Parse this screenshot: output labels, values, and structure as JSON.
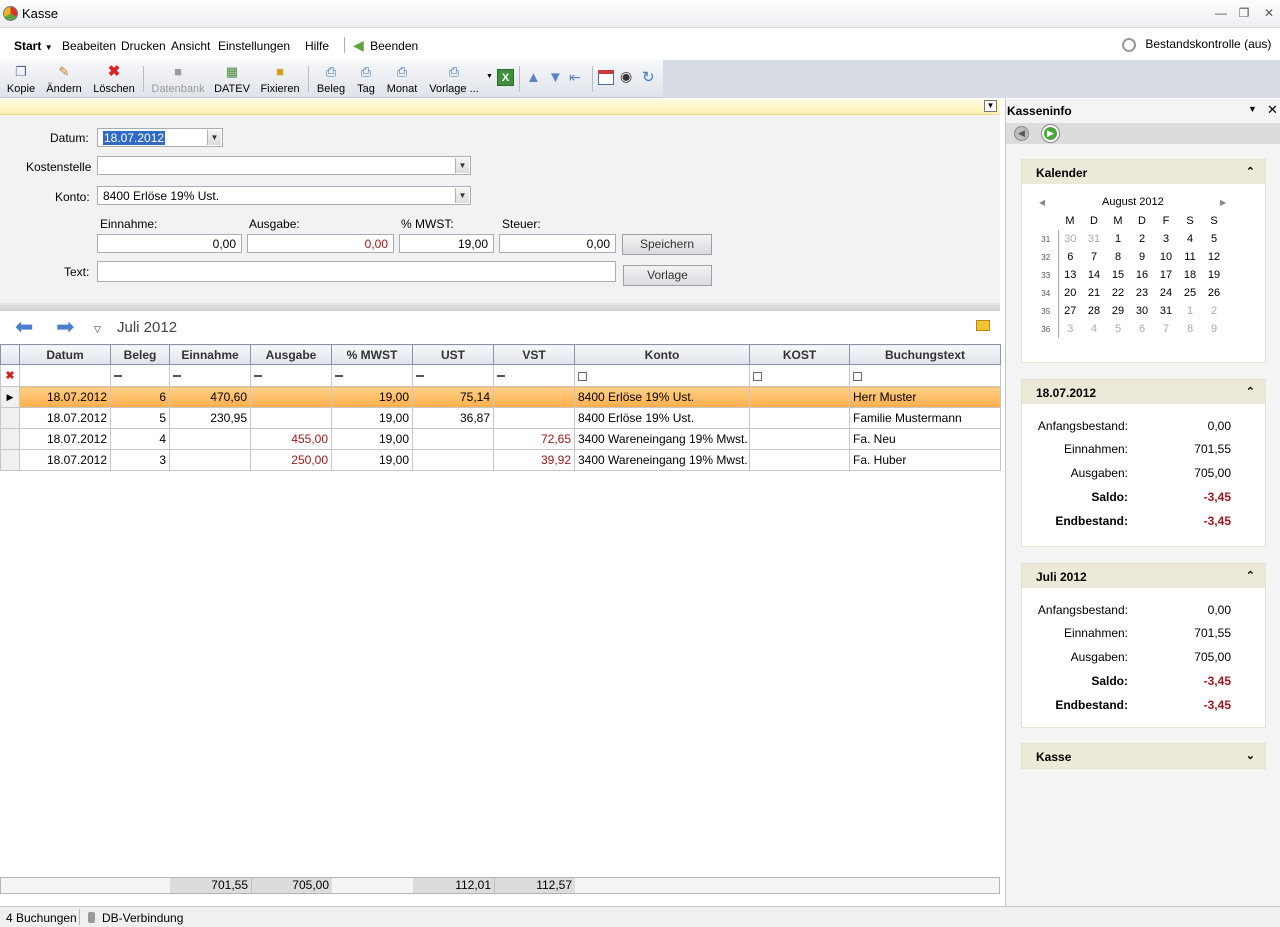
{
  "app": {
    "title": "Kasse"
  },
  "menu": {
    "start": "Start",
    "items": [
      "Beabeiten",
      "Drucken",
      "Ansicht",
      "Einstellungen",
      "Hilfe"
    ],
    "beenden": "Beenden",
    "bestandskontrolle": "Bestandskontrolle (aus)"
  },
  "toolbar": {
    "kopie": "Kopie",
    "aendern": "Ändern",
    "loeschen": "Löschen",
    "datenbank": "Datenbank",
    "datev": "DATEV",
    "fixieren": "Fixieren",
    "beleg": "Beleg",
    "tag": "Tag",
    "monat": "Monat",
    "vorlage": "Vorlage ..."
  },
  "form": {
    "datum_label": "Datum:",
    "datum_value": "18.07.2012",
    "kostenstelle_label": "Kostenstelle",
    "kostenstelle_value": "",
    "konto_label": "Konto:",
    "konto_value": "8400 Erlöse 19% Ust.",
    "einnahme_label": "Einnahme:",
    "ausgabe_label": "Ausgabe:",
    "mwst_label": "% MWST:",
    "steuer_label": "Steuer:",
    "einnahme_value": "0,00",
    "ausgabe_value": "0,00",
    "mwst_value": "19,00",
    "steuer_value": "0,00",
    "text_label": "Text:",
    "text_value": "",
    "speichern": "Speichern",
    "vorlage": "Vorlage"
  },
  "nav": {
    "month": "Juli 2012"
  },
  "grid": {
    "columns": [
      "Datum",
      "Beleg",
      "Einnahme",
      "Ausgabe",
      "% MWST",
      "UST",
      "VST",
      "Konto",
      "KOST",
      "Buchungstext"
    ],
    "rows": [
      {
        "datum": "18.07.2012",
        "beleg": "6",
        "einnahme": "470,60",
        "ausgabe": "",
        "mwst": "19,00",
        "ust": "75,14",
        "vst": "",
        "konto": "8400 Erlöse 19% Ust.",
        "kost": "",
        "text": "Herr Muster"
      },
      {
        "datum": "18.07.2012",
        "beleg": "5",
        "einnahme": "230,95",
        "ausgabe": "",
        "mwst": "19,00",
        "ust": "36,87",
        "vst": "",
        "konto": "8400 Erlöse 19% Ust.",
        "kost": "",
        "text": "Familie Mustermann"
      },
      {
        "datum": "18.07.2012",
        "beleg": "4",
        "einnahme": "",
        "ausgabe": "455,00",
        "mwst": "19,00",
        "ust": "",
        "vst": "72,65",
        "konto": "3400 Wareneingang 19% Mwst.",
        "kost": "",
        "text": "Fa. Neu"
      },
      {
        "datum": "18.07.2012",
        "beleg": "3",
        "einnahme": "",
        "ausgabe": "250,00",
        "mwst": "19,00",
        "ust": "",
        "vst": "39,92",
        "konto": "3400 Wareneingang 19% Mwst.",
        "kost": "",
        "text": "Fa. Huber"
      }
    ],
    "totals": {
      "einnahme": "701,55",
      "ausgabe": "705,00",
      "ust": "112,01",
      "vst": "112,57"
    }
  },
  "status": {
    "count": "4 Buchungen",
    "db": "DB-Verbindung"
  },
  "panel": {
    "title": "Kasseninfo",
    "calendar": {
      "header": "Kalender",
      "month": "August 2012",
      "weekdays": [
        "M",
        "D",
        "M",
        "D",
        "F",
        "S",
        "S"
      ],
      "weeks": [
        {
          "kw": "31",
          "days": [
            "30",
            "31",
            "1",
            "2",
            "3",
            "4",
            "5"
          ]
        },
        {
          "kw": "32",
          "days": [
            "6",
            "7",
            "8",
            "9",
            "10",
            "11",
            "12"
          ]
        },
        {
          "kw": "33",
          "days": [
            "13",
            "14",
            "15",
            "16",
            "17",
            "18",
            "19"
          ]
        },
        {
          "kw": "34",
          "days": [
            "20",
            "21",
            "22",
            "23",
            "24",
            "25",
            "26"
          ]
        },
        {
          "kw": "35",
          "days": [
            "27",
            "28",
            "29",
            "30",
            "31",
            "1",
            "2"
          ]
        },
        {
          "kw": "36",
          "days": [
            "3",
            "4",
            "5",
            "6",
            "7",
            "8",
            "9"
          ]
        }
      ]
    },
    "day": {
      "header": "18.07.2012",
      "anfang_label": "Anfangsbestand:",
      "anfang": "0,00",
      "ein_label": "Einnahmen:",
      "ein": "701,55",
      "aus_label": "Ausgaben:",
      "aus": "705,00",
      "saldo_label": "Saldo:",
      "saldo": "-3,45",
      "end_label": "Endbestand:",
      "end": "-3,45"
    },
    "month": {
      "header": "Juli 2012",
      "anfang_label": "Anfangsbestand:",
      "anfang": "0,00",
      "ein_label": "Einnahmen:",
      "ein": "701,55",
      "aus_label": "Ausgaben:",
      "aus": "705,00",
      "saldo_label": "Saldo:",
      "saldo": "-3,45",
      "end_label": "Endbestand:",
      "end": "-3,45"
    },
    "kasse": {
      "header": "Kasse"
    }
  },
  "colors": {
    "accent_red": "#a01818",
    "selection": "#ffae4a",
    "panel_header": "#ece9d8"
  }
}
